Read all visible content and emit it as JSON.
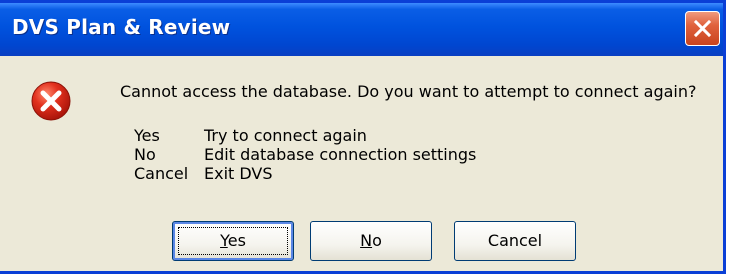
{
  "window": {
    "title": "DVS Plan & Review"
  },
  "message": "Cannot access the database. Do you want to attempt to connect again?",
  "options": [
    {
      "key": "Yes",
      "description": "Try to connect again"
    },
    {
      "key": "No",
      "description": "Edit database connection settings"
    },
    {
      "key": "Cancel",
      "description": "Exit DVS"
    }
  ],
  "buttons": {
    "yes": {
      "mnemonic": "Y",
      "rest": "es"
    },
    "no": {
      "mnemonic": "N",
      "rest": "o"
    },
    "cancel": {
      "label": "Cancel"
    }
  },
  "colors": {
    "titlebar": "#0052de",
    "dialog_bg": "#ece9d8",
    "close_button": "#e0623d",
    "error_icon": "#d21f12"
  },
  "icons": [
    "close-icon",
    "error-icon"
  ]
}
